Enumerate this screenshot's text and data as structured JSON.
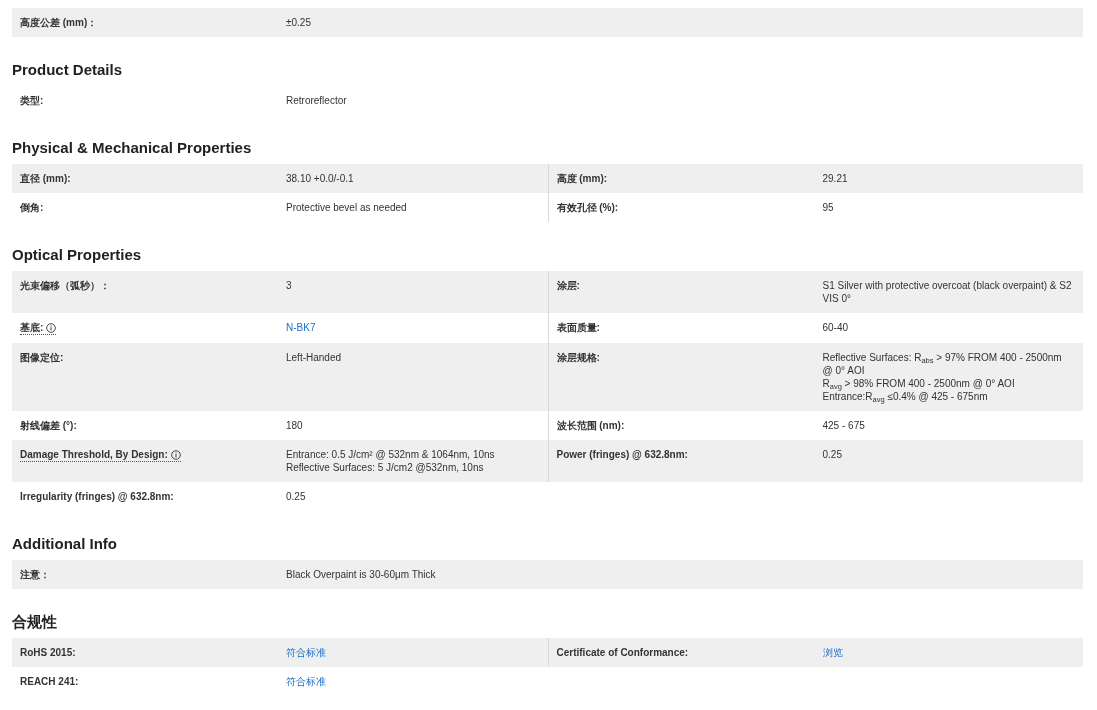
{
  "sections": [
    {
      "kind": "single",
      "rows": [
        {
          "shaded": true,
          "cells": [
            {
              "label": "高度公差 (mm)：",
              "value": "±0.25",
              "link": false,
              "info": false
            }
          ]
        }
      ]
    },
    {
      "title": "Product Details",
      "kind": "single",
      "rows": [
        {
          "shaded": false,
          "cells": [
            {
              "label": "类型:",
              "value": "Retroreflector",
              "link": false,
              "info": false
            }
          ]
        }
      ]
    },
    {
      "title": "Physical & Mechanical Properties",
      "kind": "double",
      "rows": [
        {
          "shaded": true,
          "cells": [
            {
              "label": "直径 (mm):",
              "value": "38.10 +0.0/-0.1",
              "link": false,
              "info": false
            },
            {
              "label": "高度 (mm):",
              "value": "29.21",
              "link": false,
              "info": false
            }
          ]
        },
        {
          "shaded": false,
          "cells": [
            {
              "label": "倒角:",
              "value": "Protective bevel as needed",
              "link": false,
              "info": false
            },
            {
              "label": "有效孔径 (%):",
              "value": "95",
              "link": false,
              "info": false
            }
          ]
        }
      ]
    },
    {
      "title": "Optical Properties",
      "kind": "double",
      "rows": [
        {
          "shaded": true,
          "cells": [
            {
              "label": "光束偏移（弧秒）：",
              "value": "3",
              "link": false,
              "info": false
            },
            {
              "label": "涂层:",
              "value": "S1 Silver with protective overcoat (black overpaint) & S2 VIS 0°",
              "link": false,
              "info": false
            }
          ]
        },
        {
          "shaded": false,
          "cells": [
            {
              "label": "基底:",
              "value": "N-BK7",
              "link": true,
              "info": true
            },
            {
              "label": "表面质量:",
              "value": "60-40",
              "link": false,
              "info": false
            }
          ]
        },
        {
          "shaded": true,
          "cells": [
            {
              "label": "图像定位:",
              "value": "Left-Handed",
              "link": false,
              "info": false
            },
            {
              "label": "涂层规格:",
              "value": "Reflective Surfaces: R$_{abs}$ > 97% FROM 400 - 2500nm @ 0° AOI\nR$_{avg}$ > 98% FROM 400 - 2500nm @ 0° AOI\nEntrance:R$_{avg}$ ≤0.4% @ 425 - 675nm",
              "link": false,
              "info": false
            }
          ]
        },
        {
          "shaded": false,
          "cells": [
            {
              "label": "射线偏差 (°):",
              "value": "180",
              "link": false,
              "info": false
            },
            {
              "label": "波长范围 (nm):",
              "value": "425 - 675",
              "link": false,
              "info": false
            }
          ]
        },
        {
          "shaded": true,
          "cells": [
            {
              "label": "Damage Threshold, By Design:",
              "value": "Entrance: 0.5 J/cm² @ 532nm & 1064nm, 10ns\nReflective Surfaces: 5 J/cm2 @532nm, 10ns",
              "link": false,
              "info": true
            },
            {
              "label": "Power (fringes) @ 632.8nm:",
              "value": "0.25",
              "link": false,
              "info": false
            }
          ]
        },
        {
          "shaded": false,
          "cells": [
            {
              "label": "Irregularity (fringes) @ 632.8nm:",
              "value": "0.25",
              "link": false,
              "info": false
            }
          ]
        }
      ]
    },
    {
      "title": "Additional Info",
      "kind": "single",
      "rows": [
        {
          "shaded": true,
          "cells": [
            {
              "label": "注意：",
              "value": "Black Overpaint is 30-60μm Thick",
              "link": false,
              "info": false
            }
          ]
        }
      ]
    },
    {
      "title": "合规性",
      "kind": "double",
      "rows": [
        {
          "shaded": true,
          "cells": [
            {
              "label": "RoHS 2015:",
              "value": "符合标准",
              "link": true,
              "info": false
            },
            {
              "label": "Certificate of Conformance:",
              "value": "浏览",
              "link": true,
              "info": false
            }
          ]
        },
        {
          "shaded": false,
          "cells": [
            {
              "label": "REACH 241:",
              "value": "符合标准",
              "link": true,
              "info": false
            }
          ]
        }
      ]
    }
  ]
}
